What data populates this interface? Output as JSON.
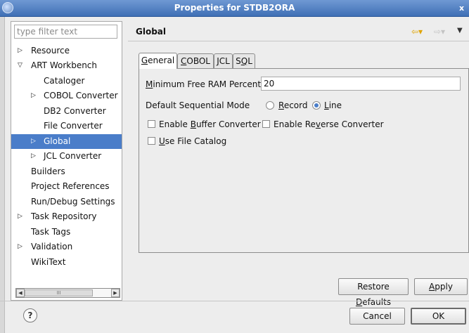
{
  "window": {
    "title": "Properties for STDB2ORA",
    "close_glyph": "x"
  },
  "filter": {
    "placeholder": "type filter text",
    "value": ""
  },
  "tree": {
    "items": [
      {
        "label": "Resource",
        "arrow": "▷",
        "level": 0
      },
      {
        "label": "ART Workbench",
        "arrow": "▽",
        "level": 0
      },
      {
        "label": "Cataloger",
        "arrow": "",
        "level": 1
      },
      {
        "label": "COBOL Converter",
        "arrow": "▷",
        "level": 1
      },
      {
        "label": "DB2 Converter",
        "arrow": "",
        "level": 1
      },
      {
        "label": "File Converter",
        "arrow": "",
        "level": 1
      },
      {
        "label": "Global",
        "arrow": "▷",
        "level": 1,
        "selected": true
      },
      {
        "label": "JCL Converter",
        "arrow": "▷",
        "level": 1
      },
      {
        "label": "Builders",
        "arrow": "",
        "level": 0
      },
      {
        "label": "Project References",
        "arrow": "",
        "level": 0
      },
      {
        "label": "Run/Debug Settings",
        "arrow": "",
        "level": 0
      },
      {
        "label": "Task Repository",
        "arrow": "▷",
        "level": 0
      },
      {
        "label": "Task Tags",
        "arrow": "",
        "level": 0
      },
      {
        "label": "Validation",
        "arrow": "▷",
        "level": 0
      },
      {
        "label": "WikiText",
        "arrow": "",
        "level": 0
      }
    ],
    "scrollbar": {
      "left_glyph": "◀",
      "right_glyph": "▶",
      "thumb_glyph": "III"
    }
  },
  "page": {
    "title": "Global",
    "nav": {
      "back_glyph": "⇦▾",
      "forward_glyph": "⇨▾",
      "menu_glyph": "▼"
    }
  },
  "tabs": [
    {
      "pre": "",
      "key": "G",
      "post": "eneral",
      "active": true
    },
    {
      "pre": "",
      "key": "C",
      "post": "OBOL",
      "active": false
    },
    {
      "pre": "",
      "key": "J",
      "post": "CL",
      "active": false
    },
    {
      "pre": "S",
      "key": "Q",
      "post": "L",
      "active": false
    }
  ],
  "general": {
    "ram": {
      "pre": "",
      "key": "M",
      "post": "inimum Free RAM Percent",
      "value": "20"
    },
    "seq_mode": {
      "label": "Default Sequential Mode",
      "record": {
        "pre": "",
        "key": "R",
        "post": "ecord"
      },
      "line": {
        "pre": "",
        "key": "L",
        "post": "ine"
      },
      "selected": "line"
    },
    "buffer": {
      "pre": "Enable ",
      "key": "B",
      "post": "uffer Converter",
      "checked": false
    },
    "reverse": {
      "pre": "Enable Re",
      "key": "v",
      "post": "erse Converter",
      "checked": false
    },
    "catalog": {
      "pre": "",
      "key": "U",
      "post": "se File Catalog",
      "checked": false
    }
  },
  "buttons": {
    "restore": {
      "pre": "Restore ",
      "key": "D",
      "post": "efaults"
    },
    "apply": {
      "pre": "",
      "key": "A",
      "post": "pply"
    },
    "cancel": "Cancel",
    "ok": "OK",
    "help_glyph": "?"
  }
}
